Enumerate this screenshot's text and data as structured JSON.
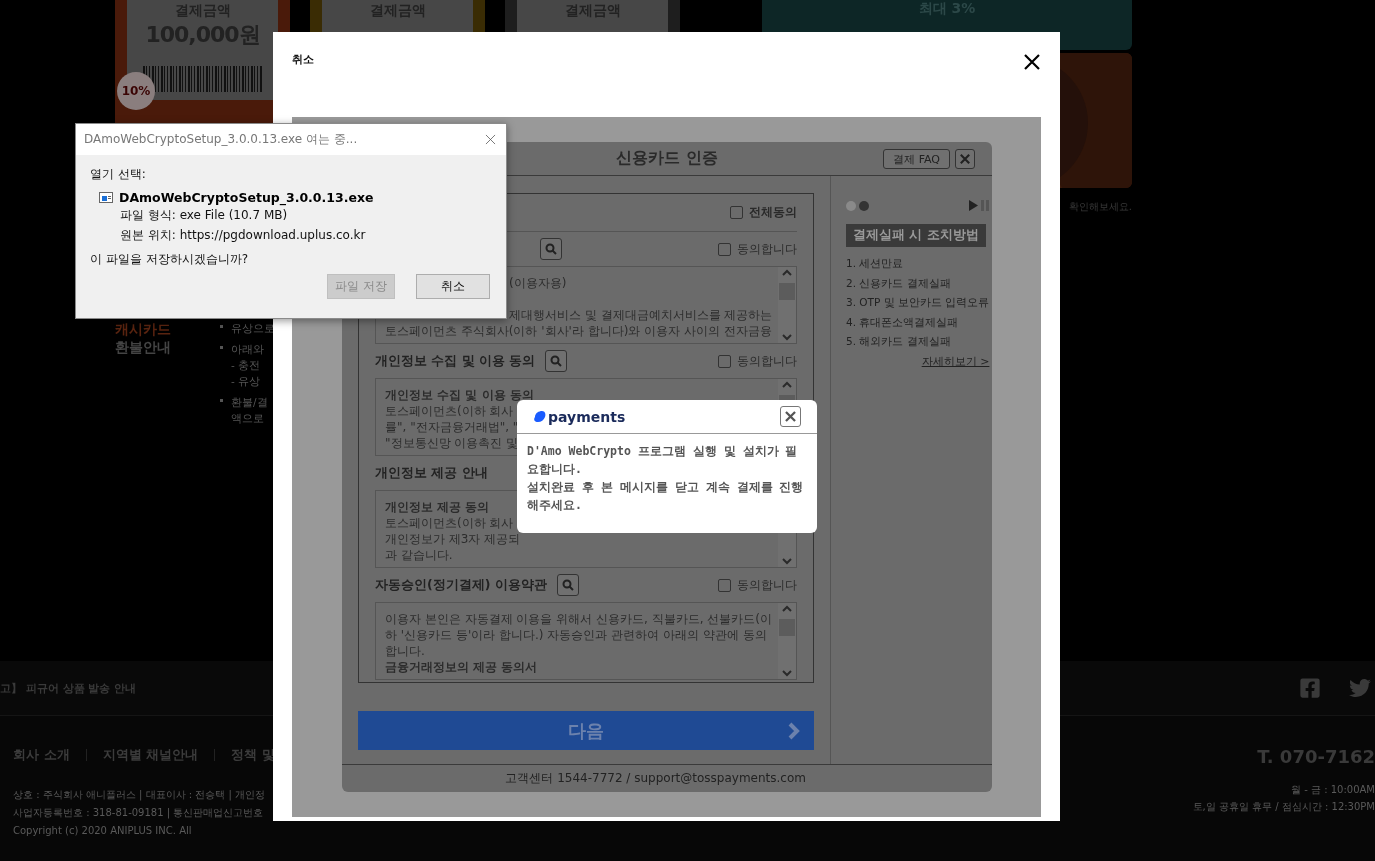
{
  "background_page": {
    "price_cards": [
      {
        "label": "결제금액",
        "amount": "100,000원",
        "badge": "10%",
        "color": "#4a1a0a"
      },
      {
        "label": "결제금액",
        "color": "#3a2c04"
      },
      {
        "label": "결제금액",
        "color": "#1e1e1e"
      }
    ],
    "promo_banner": "최대 3%",
    "promo_caption": "확인해보세요.",
    "refund": {
      "title_lines": [
        "캐시카드",
        "환불안내"
      ],
      "bullets": [
        {
          "lines": [
            "유상으로"
          ]
        },
        {
          "lines": [
            "아래와",
            "- 충전",
            "- 유상"
          ]
        },
        {
          "lines": [
            "환불/결",
            "액으로"
          ]
        }
      ]
    },
    "notice": "고】 피규어 상품 발송 안내",
    "footer_links": [
      "회사 소개",
      "지역별 채널안내",
      "정책 및"
    ],
    "company_info": [
      "상호 : 주식회사 애니플러스  |  대표이사 : 전승택  |  개인정",
      "사업자등록번호 : 318-81-09181  |  통신판매업신고번호",
      "Copyright (c) 2020 ANIPLUS INC. All"
    ],
    "phone": "T. 070-7162",
    "hours": [
      "월 - 금 : 10:00AM",
      "토,일 공휴일 휴무 / 점심시간 : 12:30PM"
    ]
  },
  "modal": {
    "title": "취소"
  },
  "payment_window": {
    "title": "신용카드 인증",
    "faq_button": "결제 FAQ",
    "all_agree": {
      "label": "전체동의",
      "checked": false
    },
    "sections": [
      {
        "search": true,
        "agree": {
          "label": "동의합니다",
          "checked": false
        },
        "lines": [
          {
            "text": "(이용자용)",
            "kind": "title"
          },
          {
            "text": "제대행서비스 및 결제대금예치서비스를 제공하는",
            "kind": "cut"
          },
          {
            "text": "토스페이먼츠 주식회사(이하 '회사'라 합니다)와 이용자 사이의 전자금융",
            "kind": "plain"
          }
        ]
      },
      {
        "title": "개인정보 수집 및 이용 동의",
        "search": true,
        "agree": {
          "label": "동의합니다",
          "checked": false
        },
        "lines": [
          {
            "text": "개인정보 수집 및 이용 동의",
            "kind": "bold"
          },
          {
            "text": "토스페이먼츠(이하 회사",
            "kind": "plain"
          },
          {
            "text": "률\", \"전자금융거래법\", \"",
            "kind": "plain"
          },
          {
            "text": "\"정보통신망 이용촉진 및",
            "kind": "plain"
          }
        ]
      },
      {
        "title": "개인정보 제공 안내",
        "search": false,
        "lines": [
          {
            "text": "개인정보 제공 동의",
            "kind": "bold"
          },
          {
            "text": "토스페이먼츠(이하 회사",
            "kind": "plain"
          },
          {
            "text": "개인정보가 제3자 제공되",
            "kind": "plain"
          },
          {
            "text": "과 같습니다.",
            "kind": "plain"
          }
        ]
      },
      {
        "title": "자동승인(정기결제) 이용약관",
        "search": true,
        "agree": {
          "label": "동의합니다",
          "checked": false
        },
        "lines": [
          {
            "text": "이용자 본인은 자동결제 이용을 위해서 신용카드, 직불카드, 선불카드(이",
            "kind": "plain"
          },
          {
            "text": "하 '신용카드 등'이라 합니다.) 자동승인과 관련하여 아래의 약관에 동의",
            "kind": "plain"
          },
          {
            "text": "합니다.",
            "kind": "plain"
          },
          {
            "text": "금융거래정보의 제공 동의서",
            "kind": "bold"
          }
        ]
      }
    ],
    "next_button": "다음",
    "footer": "고객센터 1544-7772 / support@tosspayments.com",
    "side_panel": {
      "dots": [
        {
          "selected": false
        },
        {
          "selected": true
        }
      ],
      "heading": "결제실패 시 조치방법",
      "items": [
        "1. 세션만료",
        "2. 신용카드 결제실패",
        "3. OTP 및 보안카드 입력오류",
        "4. 휴대폰소액결제실패",
        "5. 해외카드 결제실패"
      ],
      "more_link": "자세히보기 >"
    }
  },
  "payments_popup": {
    "brand": "payments",
    "paragraphs": [
      "D'Amo WebCrypto 프로그램 실행 및 설치가 필요합니다.",
      "설치완료 후 본 메시지를 닫고 계속 결제를 진행해주세요."
    ]
  },
  "download_dialog": {
    "title": "DAmoWebCryptoSetup_3.0.0.13.exe 여는 중...",
    "prompt": "열기 선택:",
    "file_name": "DAmoWebCryptoSetup_3.0.0.13.exe",
    "details": [
      "파일 형식: exe File (10.7 MB)",
      "원본 위치: https://pgdownload.uplus.co.kr"
    ],
    "question": "이 파일을 저장하시겠습니까?",
    "buttons": [
      {
        "label": "파일 저장",
        "disabled": true
      },
      {
        "label": "취소",
        "disabled": false
      }
    ]
  }
}
